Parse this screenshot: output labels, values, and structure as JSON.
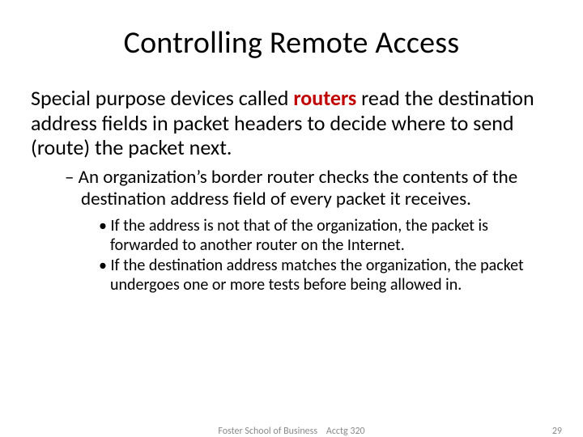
{
  "title": "Controlling Remote Access",
  "body": {
    "lead": "Special purpose devices called ",
    "emph": "routers",
    "tail": " read the destination address fields in packet headers to decide where to send (route) the packet next."
  },
  "sub1": "An organization’s border router checks the contents of the destination address field of every packet it receives.",
  "sub2": [
    "If the address is not that of the organization, the packet is forwarded to another router on the Internet.",
    "If the destination address matches the organization, the packet undergoes one or more tests before being allowed in."
  ],
  "footer": {
    "left": "Foster School of Business",
    "middle": "Acctg 320",
    "page": "29"
  }
}
